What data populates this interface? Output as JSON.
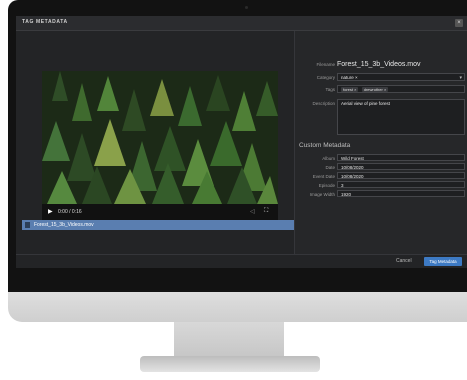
{
  "dialog": {
    "title": "TAG METADATA",
    "close_glyph": "×"
  },
  "player": {
    "play_glyph": "▶",
    "time": "0:00 / 0:16",
    "volume_glyph": "◁",
    "fullscreen_glyph": "⛶",
    "progress": 0.0
  },
  "file_list": {
    "items": [
      {
        "name": "Forest_15_3b_Videos.mov"
      }
    ]
  },
  "form": {
    "filename_label": "Filename",
    "filename_value": "Forest_15_3b_Videos.mov",
    "category_label": "Category",
    "category_value": "nature ×",
    "tags_label": "Tags",
    "tags": [
      "forest ×",
      "drewrother ×"
    ],
    "description_label": "Description",
    "description_value": "Aerial view of pine forest"
  },
  "custom_metadata": {
    "heading": "Custom Metadata",
    "fields": [
      {
        "label": "Album",
        "value": "Wild Forest"
      },
      {
        "label": "Date",
        "value": "10/08/2020"
      },
      {
        "label": "Event Date",
        "value": "10/08/2020"
      },
      {
        "label": "Episode",
        "value": "3"
      },
      {
        "label": "Image Width",
        "value": "1920"
      }
    ]
  },
  "footer": {
    "cancel_label": "Cancel",
    "primary_label": "Tag Metadata"
  }
}
